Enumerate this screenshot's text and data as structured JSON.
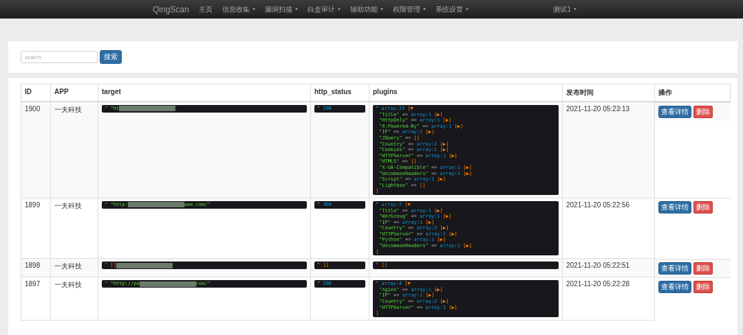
{
  "navbar": {
    "brand": "QingScan",
    "items": [
      {
        "label": "主页",
        "dropdown": false
      },
      {
        "label": "信息收集",
        "dropdown": true
      },
      {
        "label": "漏洞扫描",
        "dropdown": true
      },
      {
        "label": "白盒审计",
        "dropdown": true
      },
      {
        "label": "辅助功能",
        "dropdown": true
      },
      {
        "label": "权限管理",
        "dropdown": true
      },
      {
        "label": "系统设置",
        "dropdown": true
      }
    ],
    "user": {
      "label": "测试1",
      "dropdown": true
    }
  },
  "search": {
    "placeholder": "search",
    "button": "搜索"
  },
  "table": {
    "columns": [
      "ID",
      "APP",
      "target",
      "http_status",
      "plugins",
      "发布时间",
      "操作"
    ],
    "rows": [
      {
        "id": "1900",
        "app": "一夫科技",
        "target": {
          "caret": "^",
          "prefix": "\"ht",
          "redacted": true
        },
        "status": {
          "kind": "number",
          "caret": "^",
          "text": "200"
        },
        "plugins": {
          "kind": "array",
          "caret": "^",
          "header": "array:13",
          "open": "[▼",
          "close": "]",
          "lines": [
            {
              "key": "\"Title\"",
              "arrow": "=>",
              "value": "array:1",
              "toggle": "[▶]"
            },
            {
              "key": "\"HttpOnly\"",
              "arrow": "=>",
              "value": "array:1",
              "toggle": "[▶]"
            },
            {
              "key": "\"X-Powered-By\"",
              "arrow": "=>",
              "value": "array:1",
              "toggle": "[▶]"
            },
            {
              "key": "\"IP\"",
              "arrow": "=>",
              "value": "array:1",
              "toggle": "[▶]"
            },
            {
              "key": "\"JQuery\"",
              "arrow": "=>",
              "empty": "[]"
            },
            {
              "key": "\"Country\"",
              "arrow": "=>",
              "value": "array:2",
              "toggle": "[▶]"
            },
            {
              "key": "\"Cookies\"",
              "arrow": "=>",
              "value": "array:1",
              "toggle": "[▶]"
            },
            {
              "key": "\"HTTPServer\"",
              "arrow": "=>",
              "value": "array:1",
              "toggle": "[▶]"
            },
            {
              "key": "\"HTML5\"",
              "arrow": "=>",
              "empty": "[]"
            },
            {
              "key": "\"X-UA-Compatible\"",
              "arrow": "=>",
              "value": "array:1",
              "toggle": "[▶]"
            },
            {
              "key": "\"UncommonHeaders\"",
              "arrow": "=>",
              "value": "array:1",
              "toggle": "[▶]"
            },
            {
              "key": "\"Script\"",
              "arrow": "=>",
              "value": "array:1",
              "toggle": "[▶]"
            },
            {
              "key": "\"Lightbox\"",
              "arrow": "=>",
              "empty": "[]"
            }
          ]
        },
        "time": "2021-11-20 05:23:13",
        "view": "查看详情",
        "delete": "删除"
      },
      {
        "id": "1899",
        "app": "一夫科技",
        "target": {
          "caret": "^",
          "prefix": "\"http:",
          "redacted": true,
          "suffix": "ame.com/\""
        },
        "status": {
          "kind": "number",
          "caret": "^",
          "text": "404"
        },
        "plugins": {
          "kind": "array",
          "caret": "^",
          "header": "array:7",
          "open": "[▼",
          "close": "]",
          "lines": [
            {
              "key": "\"Title\"",
              "arrow": "=>",
              "value": "array:1",
              "toggle": "[▶]"
            },
            {
              "key": "\"Werkzeug\"",
              "arrow": "=>",
              "value": "array:1",
              "toggle": "[▶]"
            },
            {
              "key": "\"IP\"",
              "arrow": "=>",
              "value": "array:1",
              "toggle": "[▶]"
            },
            {
              "key": "\"Country\"",
              "arrow": "=>",
              "value": "array:2",
              "toggle": "[▶]"
            },
            {
              "key": "\"HTTPServer\"",
              "arrow": "=>",
              "value": "array:1",
              "toggle": "[▶]"
            },
            {
              "key": "\"Python\"",
              "arrow": "=>",
              "value": "array:1",
              "toggle": "[▶]"
            },
            {
              "key": "\"UncommonHeaders\"",
              "arrow": "=>",
              "value": "array:1",
              "toggle": "[▶]"
            }
          ]
        },
        "time": "2021-11-20 05:22:56",
        "view": "查看详情",
        "delete": "删除"
      },
      {
        "id": "1898",
        "app": "一夫科技",
        "target": {
          "caret": "^",
          "prefix": "[]",
          "redacted": true
        },
        "status": {
          "kind": "empty",
          "caret": "^",
          "text": "[]"
        },
        "plugins": {
          "kind": "empty",
          "caret": "^",
          "header": "[]"
        },
        "time": "2021-11-20 05:22:51",
        "view": "查看详情",
        "delete": "删除"
      },
      {
        "id": "1897",
        "app": "一夫科技",
        "target": {
          "caret": "^",
          "prefix": "\"http://pa",
          "redacted": true,
          "suffix": "com/\""
        },
        "status": {
          "kind": "number",
          "caret": "^",
          "text": "200"
        },
        "plugins": {
          "kind": "array",
          "caret": "^",
          "header": "array:4",
          "open": "[▼",
          "close": "]",
          "lines": [
            {
              "key": "\"nginx\"",
              "arrow": "=>",
              "value": "array:1",
              "toggle": "[▶]"
            },
            {
              "key": "\"IP\"",
              "arrow": "=>",
              "value": "array:1",
              "toggle": "[▶]"
            },
            {
              "key": "\"Country\"",
              "arrow": "=>",
              "value": "array:2",
              "toggle": "[▶]"
            },
            {
              "key": "\"HTTPServer\"",
              "arrow": "=>",
              "value": "array:1",
              "toggle": "[▶]"
            }
          ]
        },
        "time": "2021-11-20 05:22:28",
        "view": "查看详情",
        "delete": "删除"
      }
    ]
  }
}
